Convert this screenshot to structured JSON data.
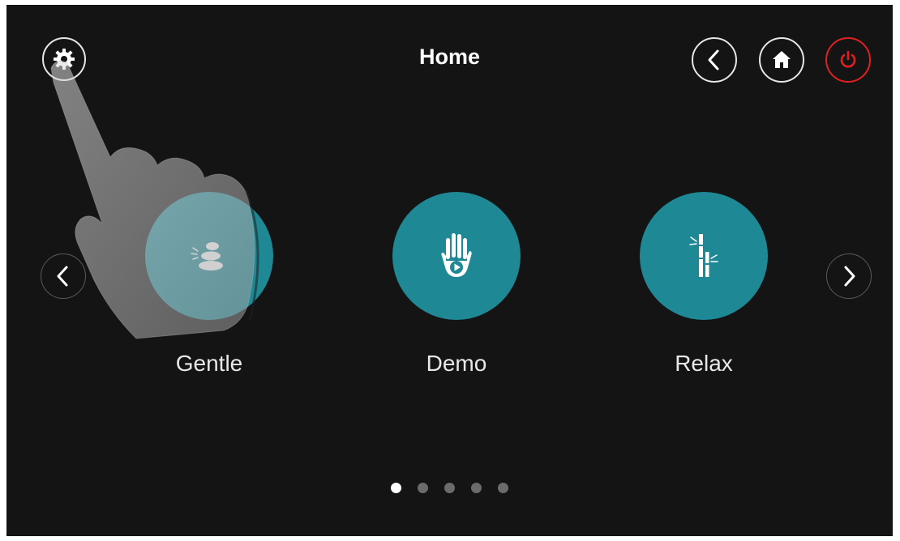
{
  "header": {
    "title": "Home",
    "icons": {
      "settings": "gear-icon",
      "back": "chevron-left-icon",
      "home": "home-icon",
      "power": "power-icon"
    },
    "power_color": "#e02020"
  },
  "carousel": {
    "accent_color": "#1e8894",
    "items": [
      {
        "label": "Gentle",
        "icon": "stacked-stones-icon"
      },
      {
        "label": "Demo",
        "icon": "hand-play-icon"
      },
      {
        "label": "Relax",
        "icon": "bamboo-icon"
      }
    ],
    "pages": 5,
    "current_page": 1
  },
  "overlay": {
    "icon": "pointing-hand-icon"
  }
}
